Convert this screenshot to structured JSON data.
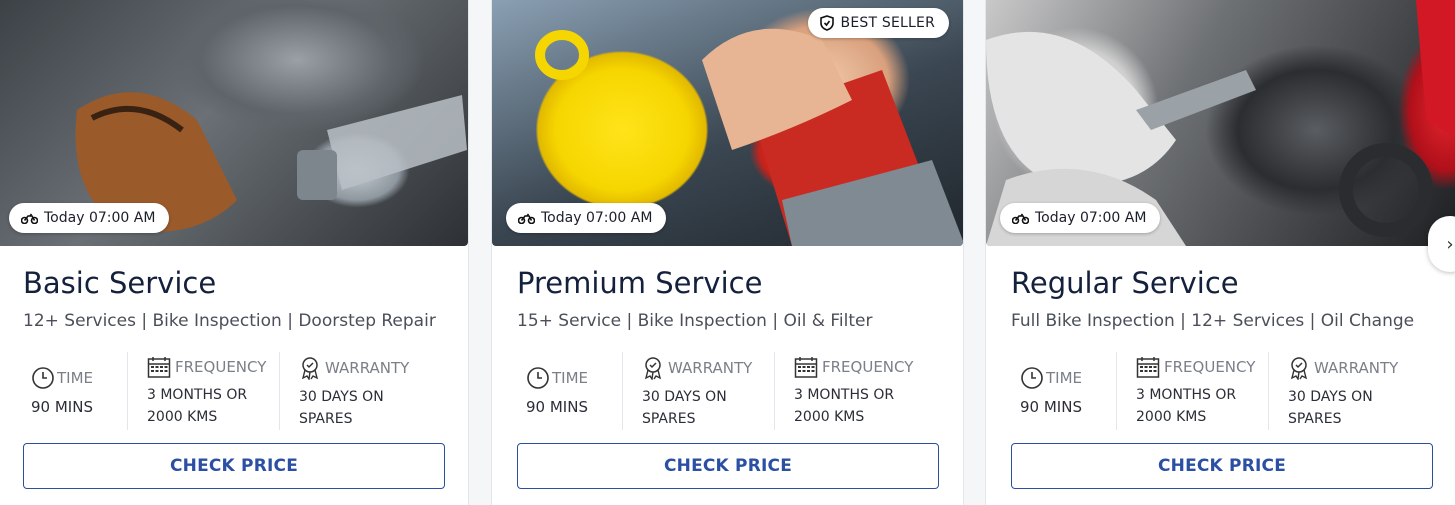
{
  "cards": [
    {
      "image": "mechanic-wrench-gloves-photo",
      "time_chip": "Today 07:00 AM",
      "badge": "",
      "title": "Basic Service",
      "subtitle": "12+ Services | Bike Inspection | Doorstep Repair",
      "specs": [
        {
          "icon": "clock-icon",
          "label": "TIME",
          "value": "90 MINS"
        },
        {
          "icon": "calendar-icon",
          "label": "FREQUENCY",
          "value": "3 MONTHS OR 2000 KMS"
        },
        {
          "icon": "warranty-badge-icon",
          "label": "WARRANTY",
          "value": "30 DAYS ON SPARES"
        }
      ],
      "button": "CHECK PRICE"
    },
    {
      "image": "oil-funnel-refill-photo",
      "time_chip": "Today 07:00 AM",
      "badge": "BEST SELLER",
      "title": "Premium Service",
      "subtitle": "15+ Service | Bike Inspection | Oil & Filter",
      "specs": [
        {
          "icon": "clock-icon",
          "label": "TIME",
          "value": "90 MINS"
        },
        {
          "icon": "warranty-badge-icon",
          "label": "WARRANTY",
          "value": "30 DAYS ON SPARES"
        },
        {
          "icon": "calendar-icon",
          "label": "FREQUENCY",
          "value": "3 MONTHS OR 2000 KMS"
        }
      ],
      "button": "CHECK PRICE"
    },
    {
      "image": "brake-caliper-repair-photo",
      "time_chip": "Today 07:00 AM",
      "badge": "",
      "title": "Regular Service",
      "subtitle": "Full Bike Inspection | 12+ Services | Oil Change",
      "specs": [
        {
          "icon": "clock-icon",
          "label": "TIME",
          "value": "90 MINS"
        },
        {
          "icon": "calendar-icon",
          "label": "FREQUENCY",
          "value": "3 MONTHS OR 2000 KMS"
        },
        {
          "icon": "warranty-badge-icon",
          "label": "WARRANTY",
          "value": "30 DAYS ON SPARES"
        }
      ],
      "button": "CHECK PRICE"
    }
  ],
  "colors": {
    "title": "#14213d",
    "button_text": "#2a4fa3",
    "button_border": "#2b4f9e"
  }
}
